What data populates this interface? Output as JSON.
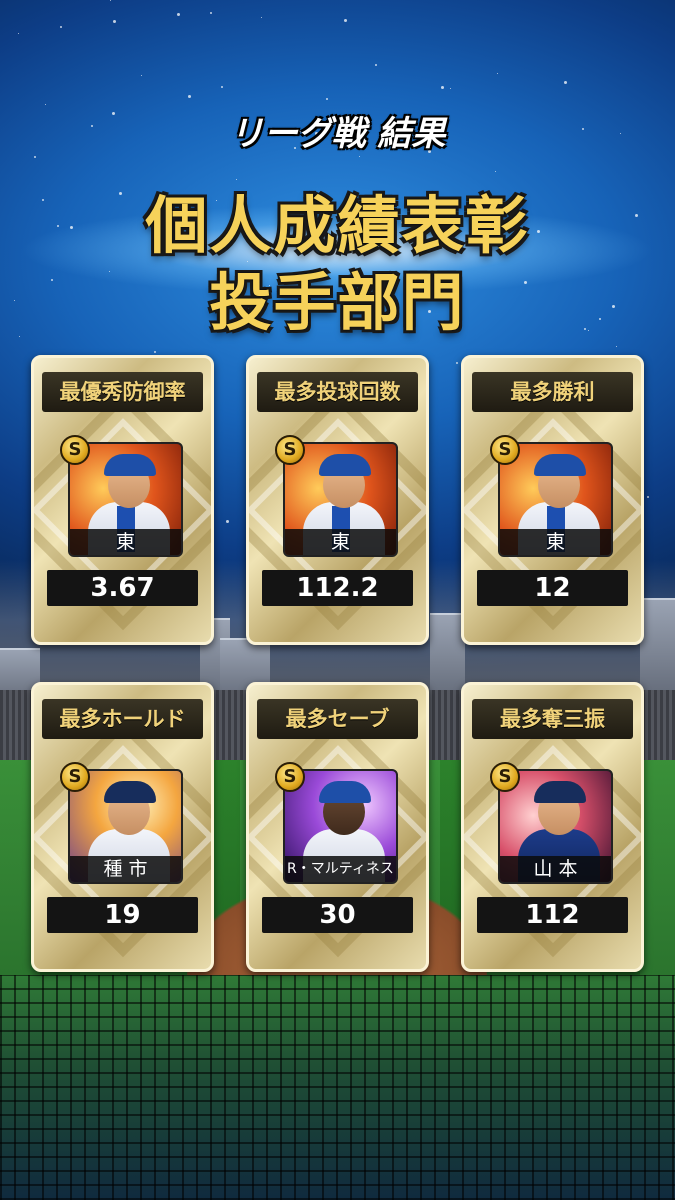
{
  "header": {
    "subtitle": "リーグ戦 結果",
    "title_line1": "個人成績表彰",
    "title_line2": "投手部門"
  },
  "awards": [
    {
      "category": "最優秀防御率",
      "player": "東",
      "value": "3.67",
      "rank_badge": "S"
    },
    {
      "category": "最多投球回数",
      "player": "東",
      "value": "112.2",
      "rank_badge": "S"
    },
    {
      "category": "最多勝利",
      "player": "東",
      "value": "12",
      "rank_badge": "S"
    },
    {
      "category": "最多ホールド",
      "player": "種 市",
      "value": "19",
      "rank_badge": "S"
    },
    {
      "category": "最多セーブ",
      "player": "R・マルティネス",
      "value": "30",
      "rank_badge": "S"
    },
    {
      "category": "最多奪三振",
      "player": "山 本",
      "value": "112",
      "rank_badge": "S"
    }
  ]
}
